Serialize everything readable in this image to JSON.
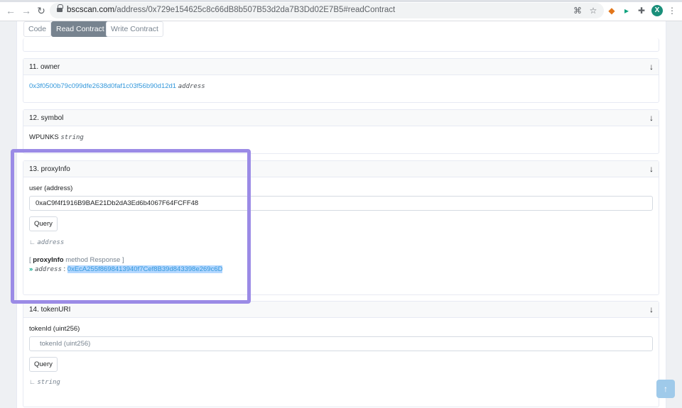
{
  "browser": {
    "url_host": "bscscan.com",
    "url_path": "/address/0x729e154625c8c66dB8b507B53d2da7B3Dd02E7B5#readContract",
    "avatar_letter": "X"
  },
  "tabs": [
    {
      "label": "Code",
      "active": false
    },
    {
      "label": "Read Contract",
      "active": true
    },
    {
      "label": "Write Contract",
      "active": false
    }
  ],
  "owner": {
    "title": "11. owner",
    "value": "0x3f0500b79c099dfe2638d0faf1c03f56b90d12d1",
    "type": "address"
  },
  "symbol": {
    "title": "12. symbol",
    "value": "WPUNKS",
    "type": "string"
  },
  "proxyInfo": {
    "title": "13. proxyInfo",
    "input_label": "user (address)",
    "input_value": "0xaC9f4f1916B9BAE21Db2dA3Ed6b4067F64FCFF48",
    "query_label": "Query",
    "return_type": "address",
    "response_open": "[",
    "response_method": "proxyInfo",
    "response_rest": "method Response ]",
    "response_chevron": "»",
    "response_type": "address",
    "response_sep": ":",
    "response_value": "0xEcA255f8698413940f7Cef8B39d843398e269c6D"
  },
  "tokenURI": {
    "title": "14. tokenURI",
    "input_label": "tokenId (uint256)",
    "input_placeholder": "tokenId (uint256)",
    "query_label": "Query",
    "return_type": "string"
  },
  "icons": {
    "collapse": "↓",
    "return_prefix": "∟",
    "scroll_top": "↑"
  },
  "colors": {
    "highlight": "#9b8be6",
    "link": "#3498db",
    "selection": "#b3d7ff"
  }
}
